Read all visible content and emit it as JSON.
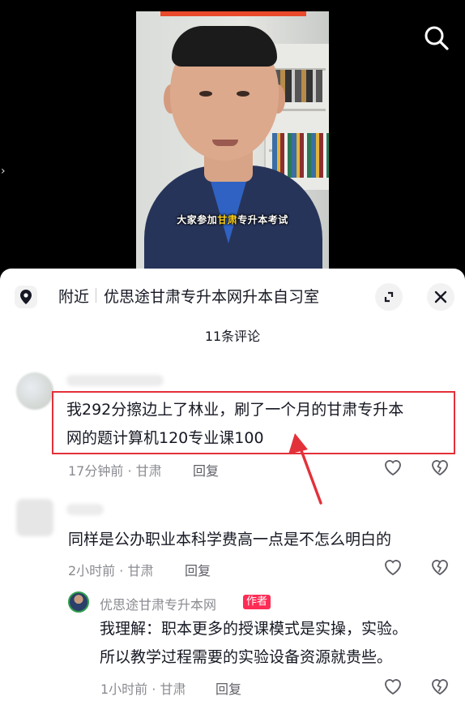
{
  "video": {
    "caption_before": "大家参加",
    "caption_highlight": "甘肃",
    "caption_after": "专升本考试",
    "caption_highlight_color": "#ffd21a"
  },
  "top_bar": {
    "search_icon": "search-icon"
  },
  "side": {
    "arrow_glyph": "›"
  },
  "location": {
    "near_label": "附近",
    "place_name": "优思途甘肃专升本网升本自习室",
    "pin_icon": "location-pin-icon",
    "expand_icon": "expand-icon",
    "close_icon": "close-icon"
  },
  "comments_count": "11条评论",
  "comments": [
    {
      "text_line1": "我292分擦边上了林业，刷了一个月的甘肃专升本",
      "text_line2": "网的题计算机120专业课100",
      "meta": "17分钟前 · 甘肃",
      "reply": "回复"
    },
    {
      "text": "同样是公办职业本科学费高一点是不怎么明白的",
      "meta": "2小时前 · 甘肃",
      "reply": "回复",
      "sub_reply": {
        "author": "优思途甘肃专升本网",
        "badge": "作者",
        "text_line1": "我理解：职本更多的授课模式是实操，实验。",
        "text_line2": "所以教学过程需要的实验设备资源就贵些。",
        "meta": "1小时前 · 甘肃",
        "reply": "回复"
      }
    }
  ],
  "colors": {
    "highlight_border": "#e3313a",
    "author_badge": "#fe2c55",
    "text": "#161823",
    "meta": "#8a8b91"
  }
}
